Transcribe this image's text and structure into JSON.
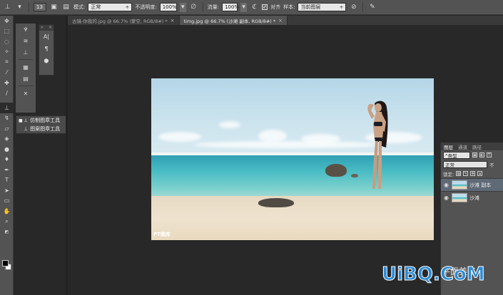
{
  "options_bar": {
    "brush_size": "13",
    "mode_label": "模式:",
    "mode_value": "正常",
    "opacity_label": "不透明度:",
    "opacity_value": "100%",
    "flow_label": "流量:",
    "flow_value": "100%",
    "aligned_label": "对齐",
    "aligned_checked": true,
    "sample_label": "样本:",
    "sample_value": "当前图层"
  },
  "tabs": [
    {
      "label": "古镜-你我的.jpg @ 66.7% (蒙空, RGB/8#) *",
      "active": false
    },
    {
      "label": "timg.jpg @ 66.7% (沙滩 副本, RGB/8#) *",
      "active": true
    }
  ],
  "tool_flyout": {
    "items": [
      {
        "label": "仿制图章工具",
        "shortcut": "S",
        "selected": true
      },
      {
        "label": "图案图章工具",
        "shortcut": "S",
        "selected": false
      }
    ]
  },
  "canvas": {
    "photo_watermark": "PT图库"
  },
  "layers_panel": {
    "tabs": [
      "图层",
      "通道",
      "路径"
    ],
    "active_tab": "图层",
    "filter_kind": "类型",
    "blend_mode": "正常",
    "opacity_label": "不",
    "lock_label": "锁定:",
    "layers": [
      {
        "name": "沙滩 副本",
        "selected": true,
        "visible": true
      },
      {
        "name": "沙滩",
        "selected": false,
        "visible": true
      }
    ]
  },
  "brand": {
    "side_text": "平面美工",
    "logo_text": "UiBQ.CoM"
  },
  "colors": {
    "accent": "#2b8bd6",
    "panel": "#535353",
    "workspace": "#282828",
    "selected_layer": "#5f6a77"
  }
}
